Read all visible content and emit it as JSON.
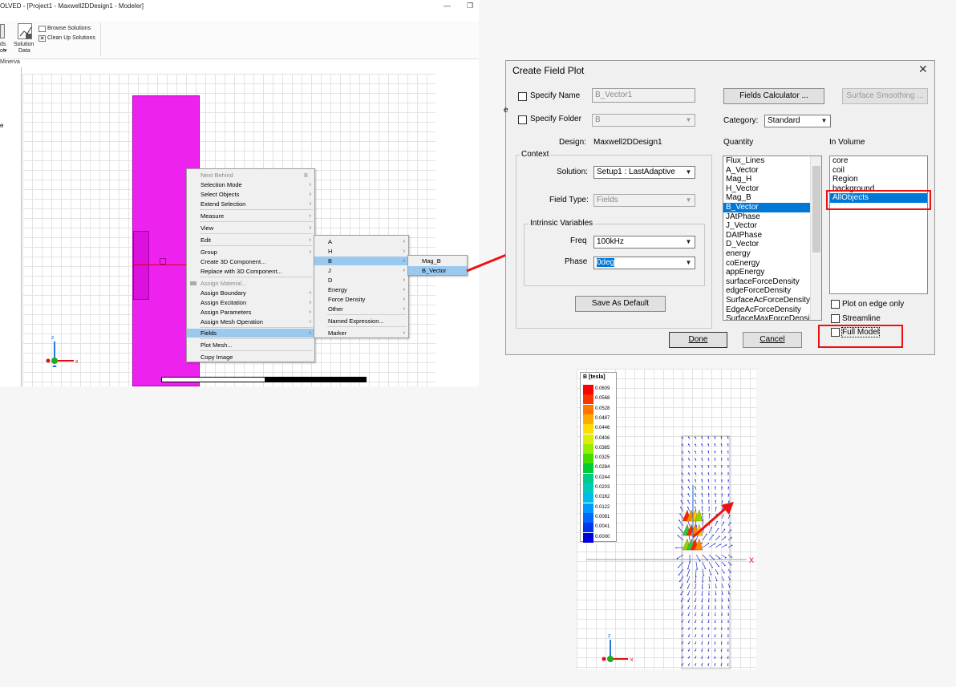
{
  "modeler": {
    "title": "OLVED - [Project1 - Maxwell2DDesign1 - Modeler]",
    "ribbon": {
      "fields_label_a": "ds",
      "fields_label_b": "ot",
      "solution_data_a": "Solution",
      "solution_data_b": "Data",
      "browse_solutions": "Browse Solutions",
      "clean_up_solutions": "Clean Up Solutions",
      "section_label": "Minerva"
    },
    "left_pane_text": "e",
    "context_menu": {
      "items": [
        {
          "label": "Next Behind",
          "key": "B",
          "disabled": true
        },
        {
          "label": "Selection Mode",
          "submenu": true
        },
        {
          "label": "Select Objects",
          "submenu": true
        },
        {
          "label": "Extend Selection",
          "submenu": true
        },
        {
          "label": "Measure",
          "submenu": true
        },
        {
          "label": "View",
          "submenu": true
        },
        {
          "label": "Edit",
          "submenu": true
        },
        {
          "label": "Group",
          "submenu": true
        },
        {
          "label": "Create 3D Component...",
          "submenu": false
        },
        {
          "label": "Replace with 3D Component...",
          "submenu": false
        },
        {
          "label": "Assign Material...",
          "disabled": true
        },
        {
          "label": "Assign Boundary",
          "submenu": true
        },
        {
          "label": "Assign Excitation",
          "submenu": true
        },
        {
          "label": "Assign Parameters",
          "submenu": true
        },
        {
          "label": "Assign Mesh Operation",
          "submenu": true
        },
        {
          "label": "Fields",
          "submenu": true,
          "selected": true
        },
        {
          "label": "Plot Mesh..."
        },
        {
          "label": "Copy Image"
        }
      ]
    },
    "fields_submenu": {
      "items": [
        {
          "label": "A",
          "submenu": true
        },
        {
          "label": "H",
          "submenu": true
        },
        {
          "label": "B",
          "submenu": true,
          "selected": true
        },
        {
          "label": "J",
          "submenu": true
        },
        {
          "label": "D",
          "submenu": true
        },
        {
          "label": "Energy",
          "submenu": true
        },
        {
          "label": "Force Density",
          "submenu": true
        },
        {
          "label": "Other",
          "submenu": true
        },
        {
          "label": "Named Expression..."
        },
        {
          "label": "Marker",
          "submenu": true
        }
      ]
    },
    "b_submenu": {
      "items": [
        {
          "label": "Mag_B"
        },
        {
          "label": "B_Vector",
          "selected": true
        }
      ]
    },
    "axis": {
      "z": "z",
      "x": "x"
    }
  },
  "dialog": {
    "title": "Create Field Plot",
    "specify_name_label": "Specify Name",
    "name_value": "B_Vector1",
    "specify_folder_label": "Specify Folder",
    "folder_value": "B",
    "fields_calculator": "Fields Calculator ...",
    "surface_smoothing": "Surface Smoothing ...",
    "category_label": "Category:",
    "category_value": "Standard",
    "design_label": "Design:",
    "design_value": "Maxwell2DDesign1",
    "context_title": "Context",
    "solution_label": "Solution:",
    "solution_value": "Setup1 : LastAdaptive",
    "field_type_label": "Field Type:",
    "field_type_value": "Fields",
    "intrinsic_title": "Intrinsic Variables",
    "freq_label": "Freq",
    "freq_value": "100kHz",
    "phase_label": "Phase",
    "phase_value": "0deg",
    "save_default": "Save As Default",
    "quantity_label": "Quantity",
    "quantity_items": [
      "Flux_Lines",
      "A_Vector",
      "Mag_H",
      "H_Vector",
      "Mag_B",
      "B_Vector",
      "JAtPhase",
      "J_Vector",
      "DAtPhase",
      "D_Vector",
      "energy",
      "coEnergy",
      "appEnergy",
      "surfaceForceDensity",
      "edgeForceDensity",
      "SurfaceAcForceDensity",
      "EdgeAcForceDensity",
      "SurfaceMaxForceDensit"
    ],
    "quantity_selected": "B_Vector",
    "in_volume_label": "In Volume",
    "volume_items": [
      "core",
      "coil",
      "Region",
      "background",
      "AllObjects"
    ],
    "volume_selected": "AllObjects",
    "plot_on_edge_only": "Plot on edge only",
    "streamline": "Streamline",
    "full_model": "Full Model",
    "done": "Done",
    "cancel": "Cancel",
    "left_edge_text": "e"
  },
  "plot": {
    "legend_title": "B [tesla]",
    "legend_values": [
      "0.0609",
      "0.0568",
      "0.0528",
      "0.0487",
      "0.0446",
      "0.0406",
      "0.0365",
      "0.0325",
      "0.0284",
      "0.0244",
      "0.0203",
      "0.0162",
      "0.0122",
      "0.0081",
      "0.0041",
      "0.0000"
    ],
    "legend_colors": [
      "#ff0000",
      "#ff3300",
      "#ff7700",
      "#ffaa00",
      "#ffdd00",
      "#ddee00",
      "#99ee00",
      "#44dd00",
      "#00cc33",
      "#00cc88",
      "#00ccbb",
      "#00bbee",
      "#0099ff",
      "#0066ff",
      "#0033ee",
      "#0000dd"
    ],
    "axis": {
      "z": "z",
      "x": "X",
      "x_small": "x"
    }
  },
  "colors": {
    "accent": "#0078d7",
    "menu_highlight": "#99c9ef",
    "magenta": "#ee22ee",
    "annotation_red": "#e11111"
  }
}
